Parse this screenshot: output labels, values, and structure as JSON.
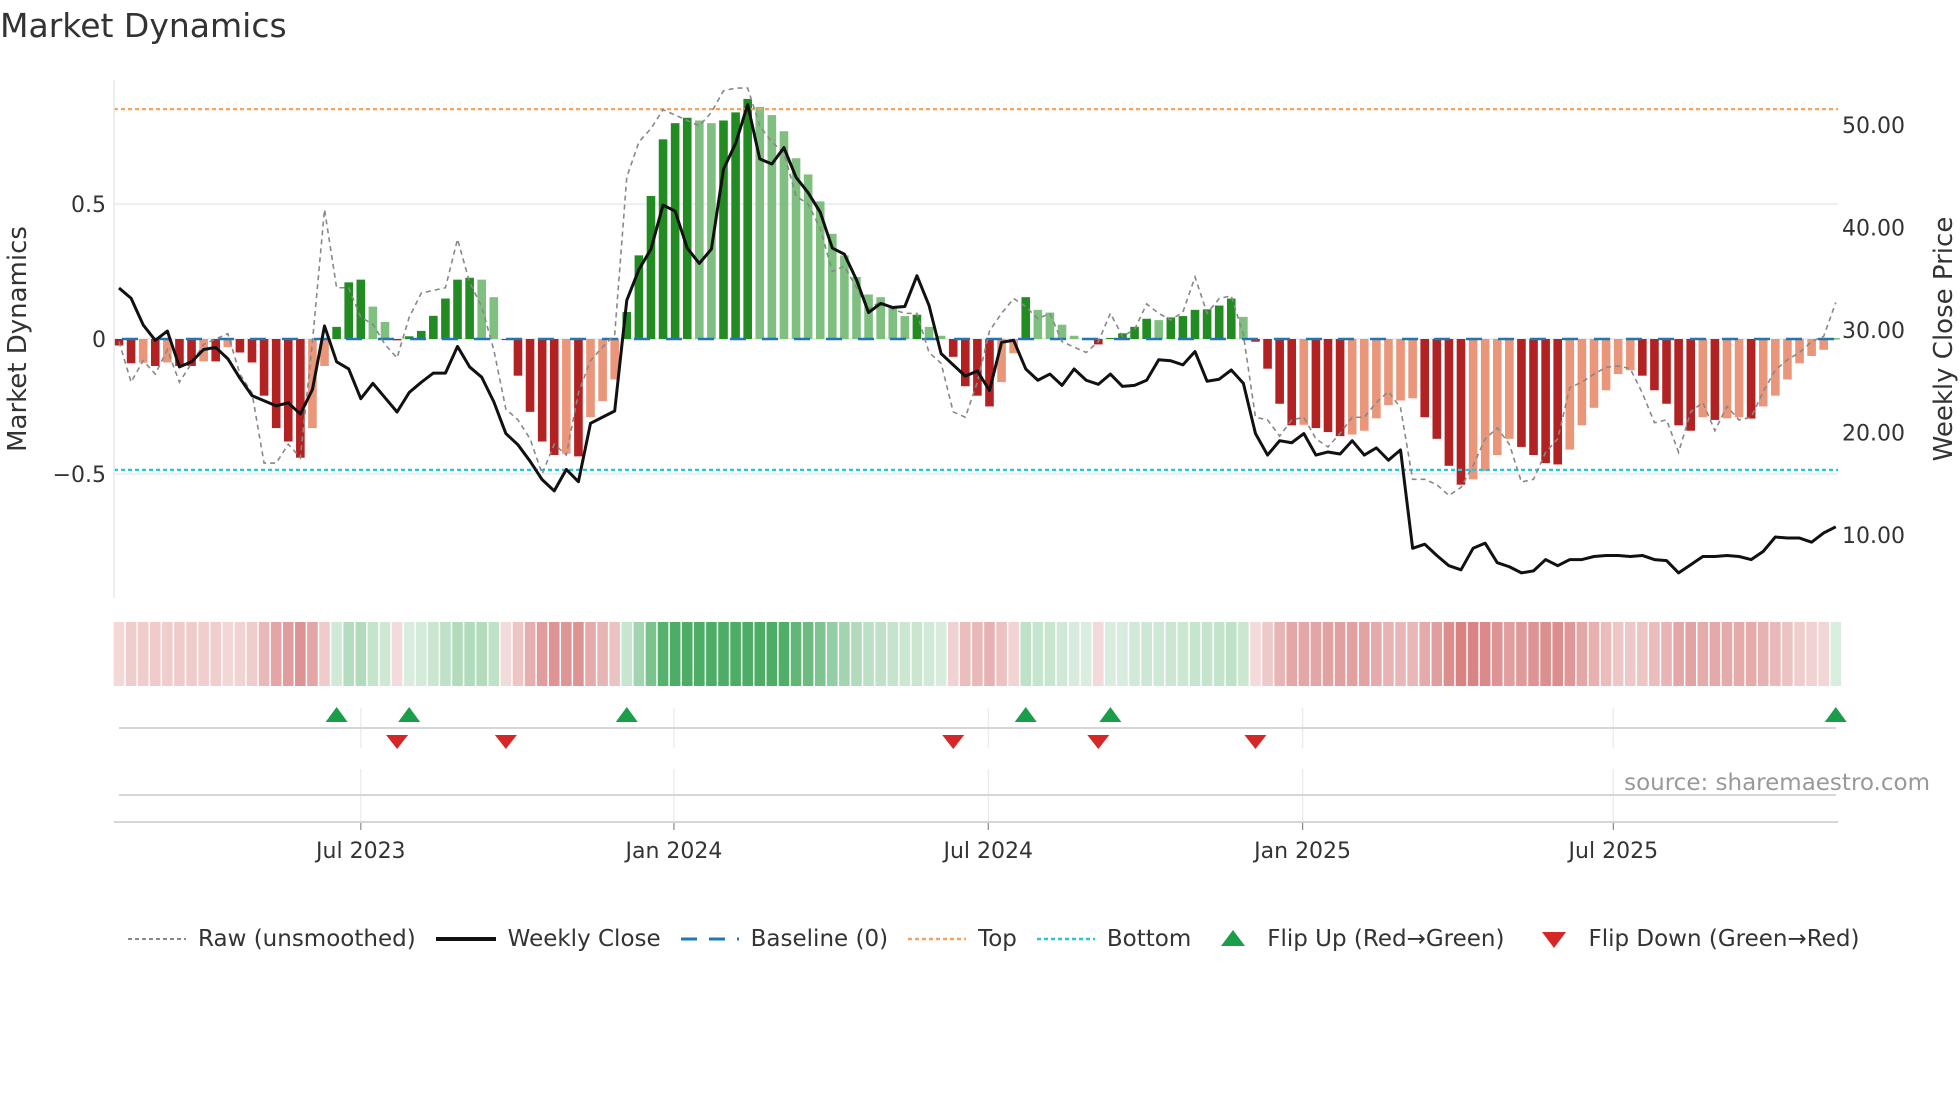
{
  "title": "Market Dynamics",
  "source": "source: sharemaestro.com",
  "legend": {
    "raw": "Raw (unsmoothed)",
    "close": "Weekly Close",
    "baseline": "Baseline (0)",
    "top": "Top",
    "bottom": "Bottom",
    "flip_up": "Flip Up (Red→Green)",
    "flip_down": "Flip Down (Green→Red)"
  },
  "colors": {
    "strong_green": "#228b22",
    "weak_green": "#7fbf7f",
    "strong_red": "#b22222",
    "weak_red": "#e9967a",
    "raw": "#888888",
    "close": "#111111",
    "baseline": "#1f77b4",
    "top": "#f4a460",
    "bottom": "#22c8d8",
    "flip_up": "#1a9e4a",
    "flip_down": "#d62728",
    "strip_green": "#2e9e4a",
    "strip_red": "#c23b3b"
  },
  "chart_data": {
    "type": "bar",
    "title": "Market Dynamics",
    "ylabel": "Market Dynamics",
    "y2label": "Weekly Close Price",
    "ylim": [
      -0.96,
      0.96
    ],
    "y2lim": [
      3.85,
      54.4
    ],
    "yticks": [
      {
        "v": 0.5,
        "label": "0.5"
      },
      {
        "v": 0,
        "label": "0"
      },
      {
        "v": -0.5,
        "label": "−0.5"
      }
    ],
    "y2ticks": [
      {
        "v": 50,
        "label": "50.00"
      },
      {
        "v": 40,
        "label": "40.00"
      },
      {
        "v": 30,
        "label": "30.00"
      },
      {
        "v": 20,
        "label": "20.00"
      },
      {
        "v": 10,
        "label": "10.00"
      }
    ],
    "xticks": [
      {
        "week": 20,
        "label": "Jul 2023"
      },
      {
        "week": 45.9,
        "label": "Jan 2024"
      },
      {
        "week": 71.9,
        "label": "Jul 2024"
      },
      {
        "week": 97.9,
        "label": "Jan 2025"
      },
      {
        "week": 123.6,
        "label": "Jul 2025"
      }
    ],
    "top_level": 0.852,
    "bottom_level": -0.485,
    "baseline": 0,
    "dynamics": [
      -0.024,
      -0.09,
      -0.088,
      -0.1,
      -0.087,
      -0.1,
      -0.1,
      -0.083,
      -0.083,
      -0.03,
      -0.05,
      -0.087,
      -0.21,
      -0.33,
      -0.38,
      -0.44,
      -0.33,
      -0.1,
      0.045,
      0.21,
      0.22,
      0.12,
      0.063,
      -0.005,
      0.01,
      0.03,
      0.086,
      0.15,
      0.22,
      0.227,
      0.22,
      0.155,
      -0.004,
      -0.136,
      -0.27,
      -0.38,
      -0.43,
      -0.425,
      -0.435,
      -0.29,
      -0.23,
      -0.15,
      0.1,
      0.31,
      0.53,
      0.74,
      0.8,
      0.82,
      0.81,
      0.8,
      0.81,
      0.84,
      0.89,
      0.86,
      0.83,
      0.77,
      0.67,
      0.61,
      0.51,
      0.39,
      0.31,
      0.23,
      0.165,
      0.155,
      0.12,
      0.085,
      0.09,
      0.045,
      0.012,
      -0.066,
      -0.175,
      -0.21,
      -0.25,
      -0.16,
      -0.053,
      0.155,
      0.108,
      0.098,
      0.053,
      0.012,
      0.002,
      -0.02,
      0.004,
      0.021,
      0.045,
      0.075,
      0.07,
      0.08,
      0.085,
      0.108,
      0.11,
      0.124,
      0.15,
      0.082,
      -0.01,
      -0.11,
      -0.24,
      -0.32,
      -0.318,
      -0.33,
      -0.345,
      -0.36,
      -0.354,
      -0.34,
      -0.294,
      -0.245,
      -0.228,
      -0.22,
      -0.29,
      -0.37,
      -0.47,
      -0.54,
      -0.52,
      -0.49,
      -0.43,
      -0.37,
      -0.4,
      -0.43,
      -0.46,
      -0.465,
      -0.41,
      -0.32,
      -0.255,
      -0.19,
      -0.13,
      -0.116,
      -0.136,
      -0.19,
      -0.24,
      -0.32,
      -0.34,
      -0.29,
      -0.3,
      -0.294,
      -0.29,
      -0.295,
      -0.25,
      -0.21,
      -0.15,
      -0.09,
      -0.063,
      -0.04,
      0.002
    ],
    "raw": [
      -0.01,
      -0.16,
      -0.08,
      -0.13,
      -0.04,
      -0.16,
      -0.09,
      -0.02,
      0.0,
      0.02,
      -0.13,
      -0.2,
      -0.46,
      -0.46,
      -0.39,
      -0.44,
      -0.01,
      0.48,
      0.19,
      0.19,
      0.08,
      0.055,
      -0.02,
      -0.07,
      0.08,
      0.17,
      0.18,
      0.19,
      0.37,
      0.21,
      0.12,
      -0.04,
      -0.26,
      -0.3,
      -0.37,
      -0.5,
      -0.39,
      -0.43,
      -0.2,
      -0.08,
      -0.03,
      0.016,
      0.6,
      0.73,
      0.78,
      0.85,
      0.83,
      0.81,
      0.79,
      0.84,
      0.92,
      0.93,
      0.93,
      0.79,
      0.73,
      0.69,
      0.53,
      0.5,
      0.41,
      0.25,
      0.27,
      0.19,
      0.11,
      0.14,
      0.11,
      0.095,
      0.095,
      -0.05,
      -0.09,
      -0.27,
      -0.29,
      -0.16,
      0.03,
      0.095,
      0.15,
      0.12,
      0.075,
      0.095,
      -0.01,
      -0.03,
      -0.05,
      -0.01,
      0.095,
      0.01,
      0.035,
      0.13,
      0.095,
      0.07,
      0.1,
      0.23,
      0.095,
      0.15,
      0.16,
      0.016,
      -0.29,
      -0.3,
      -0.36,
      -0.3,
      -0.29,
      -0.37,
      -0.4,
      -0.35,
      -0.29,
      -0.29,
      -0.235,
      -0.195,
      -0.255,
      -0.52,
      -0.52,
      -0.54,
      -0.58,
      -0.55,
      -0.47,
      -0.37,
      -0.33,
      -0.39,
      -0.53,
      -0.52,
      -0.42,
      -0.37,
      -0.18,
      -0.16,
      -0.13,
      -0.105,
      -0.1,
      -0.11,
      -0.2,
      -0.31,
      -0.3,
      -0.42,
      -0.27,
      -0.235,
      -0.34,
      -0.25,
      -0.3,
      -0.29,
      -0.195,
      -0.115,
      -0.077,
      -0.05,
      -0.01,
      0.01,
      0.135
    ],
    "weekly_close": [
      34.1,
      33.1,
      30.5,
      29.0,
      29.9,
      26.4,
      26.9,
      28.1,
      28.3,
      27.2,
      25.3,
      23.6,
      23.1,
      22.6,
      22.9,
      21.8,
      24.2,
      30.4,
      26.9,
      26.2,
      23.3,
      24.8,
      23.4,
      22.0,
      23.9,
      24.9,
      25.8,
      25.8,
      28.4,
      26.4,
      25.4,
      23.0,
      19.9,
      18.8,
      17.2,
      15.4,
      14.3,
      16.4,
      15.2,
      20.9,
      21.5,
      22.1,
      32.9,
      35.9,
      37.9,
      42.2,
      41.6,
      38.0,
      36.5,
      37.9,
      45.7,
      48.2,
      52.0,
      46.7,
      46.2,
      47.8,
      44.9,
      43.4,
      41.5,
      38.0,
      37.4,
      34.9,
      31.7,
      32.6,
      32.2,
      32.3,
      35.3,
      32.4,
      27.7,
      26.6,
      25.5,
      26.0,
      24.1,
      28.8,
      29.0,
      26.2,
      25.1,
      25.7,
      24.6,
      26.2,
      25.1,
      24.7,
      25.7,
      24.5,
      24.6,
      25.1,
      27.1,
      27.0,
      26.6,
      27.9,
      25.0,
      25.2,
      26.1,
      24.8,
      19.9,
      17.8,
      19.2,
      19.0,
      19.9,
      17.8,
      18.1,
      17.9,
      19.2,
      17.8,
      18.5,
      17.3,
      18.3,
      8.7,
      9.1,
      8.0,
      7.0,
      6.6,
      8.7,
      9.2,
      7.3,
      6.9,
      6.3,
      6.5,
      7.6,
      7.0,
      7.6,
      7.6,
      7.9,
      8.0,
      8.0,
      7.9,
      8.0,
      7.6,
      7.5,
      6.3,
      7.1,
      7.9,
      7.9,
      8.0,
      7.9,
      7.6,
      8.4,
      9.8,
      9.7,
      9.7,
      9.3,
      10.2,
      10.8
    ],
    "flip_up_weeks": [
      18,
      24,
      42,
      75,
      82,
      142
    ],
    "flip_down_weeks": [
      23,
      32,
      69,
      81,
      94
    ]
  }
}
